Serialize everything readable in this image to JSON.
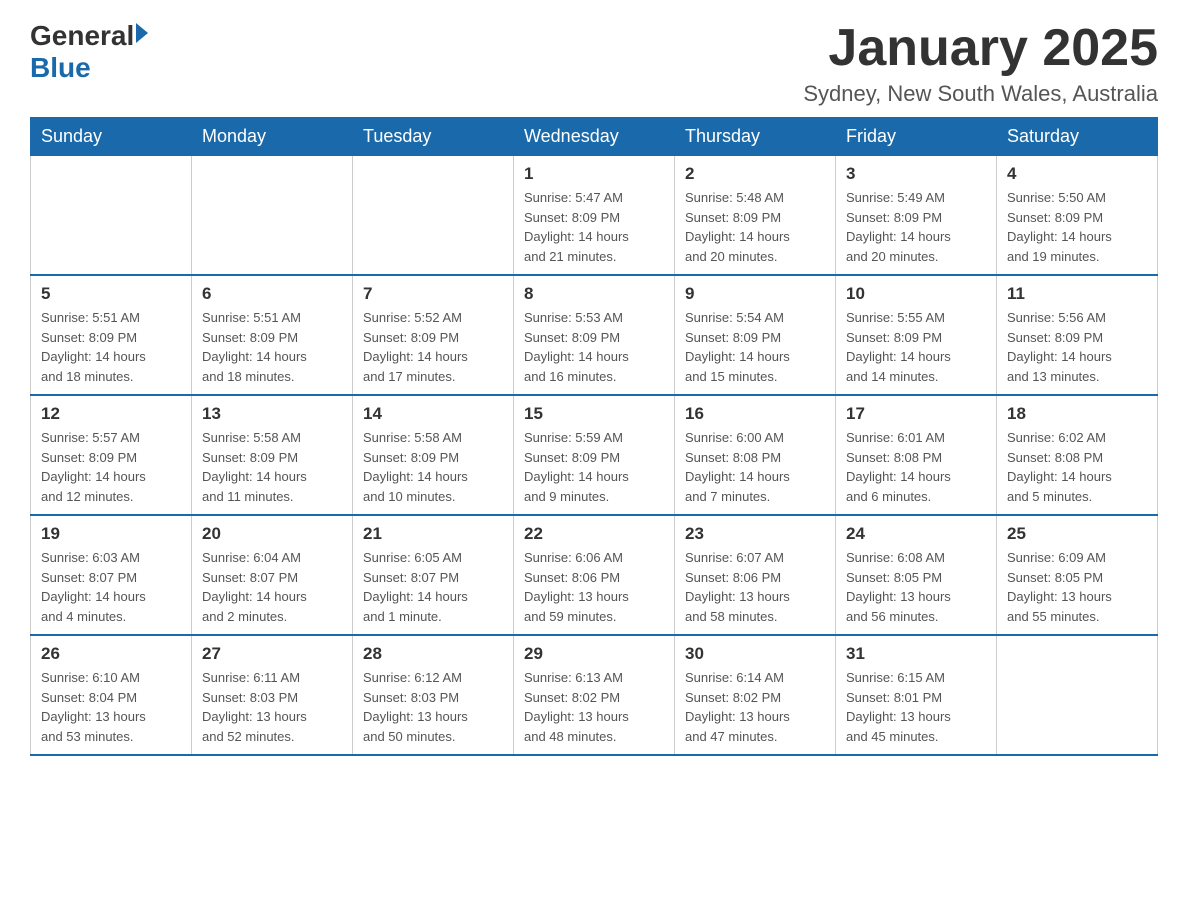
{
  "logo": {
    "general": "General",
    "blue": "Blue"
  },
  "title": "January 2025",
  "subtitle": "Sydney, New South Wales, Australia",
  "days_header": [
    "Sunday",
    "Monday",
    "Tuesday",
    "Wednesday",
    "Thursday",
    "Friday",
    "Saturday"
  ],
  "weeks": [
    [
      {
        "day": "",
        "info": ""
      },
      {
        "day": "",
        "info": ""
      },
      {
        "day": "",
        "info": ""
      },
      {
        "day": "1",
        "info": "Sunrise: 5:47 AM\nSunset: 8:09 PM\nDaylight: 14 hours\nand 21 minutes."
      },
      {
        "day": "2",
        "info": "Sunrise: 5:48 AM\nSunset: 8:09 PM\nDaylight: 14 hours\nand 20 minutes."
      },
      {
        "day": "3",
        "info": "Sunrise: 5:49 AM\nSunset: 8:09 PM\nDaylight: 14 hours\nand 20 minutes."
      },
      {
        "day": "4",
        "info": "Sunrise: 5:50 AM\nSunset: 8:09 PM\nDaylight: 14 hours\nand 19 minutes."
      }
    ],
    [
      {
        "day": "5",
        "info": "Sunrise: 5:51 AM\nSunset: 8:09 PM\nDaylight: 14 hours\nand 18 minutes."
      },
      {
        "day": "6",
        "info": "Sunrise: 5:51 AM\nSunset: 8:09 PM\nDaylight: 14 hours\nand 18 minutes."
      },
      {
        "day": "7",
        "info": "Sunrise: 5:52 AM\nSunset: 8:09 PM\nDaylight: 14 hours\nand 17 minutes."
      },
      {
        "day": "8",
        "info": "Sunrise: 5:53 AM\nSunset: 8:09 PM\nDaylight: 14 hours\nand 16 minutes."
      },
      {
        "day": "9",
        "info": "Sunrise: 5:54 AM\nSunset: 8:09 PM\nDaylight: 14 hours\nand 15 minutes."
      },
      {
        "day": "10",
        "info": "Sunrise: 5:55 AM\nSunset: 8:09 PM\nDaylight: 14 hours\nand 14 minutes."
      },
      {
        "day": "11",
        "info": "Sunrise: 5:56 AM\nSunset: 8:09 PM\nDaylight: 14 hours\nand 13 minutes."
      }
    ],
    [
      {
        "day": "12",
        "info": "Sunrise: 5:57 AM\nSunset: 8:09 PM\nDaylight: 14 hours\nand 12 minutes."
      },
      {
        "day": "13",
        "info": "Sunrise: 5:58 AM\nSunset: 8:09 PM\nDaylight: 14 hours\nand 11 minutes."
      },
      {
        "day": "14",
        "info": "Sunrise: 5:58 AM\nSunset: 8:09 PM\nDaylight: 14 hours\nand 10 minutes."
      },
      {
        "day": "15",
        "info": "Sunrise: 5:59 AM\nSunset: 8:09 PM\nDaylight: 14 hours\nand 9 minutes."
      },
      {
        "day": "16",
        "info": "Sunrise: 6:00 AM\nSunset: 8:08 PM\nDaylight: 14 hours\nand 7 minutes."
      },
      {
        "day": "17",
        "info": "Sunrise: 6:01 AM\nSunset: 8:08 PM\nDaylight: 14 hours\nand 6 minutes."
      },
      {
        "day": "18",
        "info": "Sunrise: 6:02 AM\nSunset: 8:08 PM\nDaylight: 14 hours\nand 5 minutes."
      }
    ],
    [
      {
        "day": "19",
        "info": "Sunrise: 6:03 AM\nSunset: 8:07 PM\nDaylight: 14 hours\nand 4 minutes."
      },
      {
        "day": "20",
        "info": "Sunrise: 6:04 AM\nSunset: 8:07 PM\nDaylight: 14 hours\nand 2 minutes."
      },
      {
        "day": "21",
        "info": "Sunrise: 6:05 AM\nSunset: 8:07 PM\nDaylight: 14 hours\nand 1 minute."
      },
      {
        "day": "22",
        "info": "Sunrise: 6:06 AM\nSunset: 8:06 PM\nDaylight: 13 hours\nand 59 minutes."
      },
      {
        "day": "23",
        "info": "Sunrise: 6:07 AM\nSunset: 8:06 PM\nDaylight: 13 hours\nand 58 minutes."
      },
      {
        "day": "24",
        "info": "Sunrise: 6:08 AM\nSunset: 8:05 PM\nDaylight: 13 hours\nand 56 minutes."
      },
      {
        "day": "25",
        "info": "Sunrise: 6:09 AM\nSunset: 8:05 PM\nDaylight: 13 hours\nand 55 minutes."
      }
    ],
    [
      {
        "day": "26",
        "info": "Sunrise: 6:10 AM\nSunset: 8:04 PM\nDaylight: 13 hours\nand 53 minutes."
      },
      {
        "day": "27",
        "info": "Sunrise: 6:11 AM\nSunset: 8:03 PM\nDaylight: 13 hours\nand 52 minutes."
      },
      {
        "day": "28",
        "info": "Sunrise: 6:12 AM\nSunset: 8:03 PM\nDaylight: 13 hours\nand 50 minutes."
      },
      {
        "day": "29",
        "info": "Sunrise: 6:13 AM\nSunset: 8:02 PM\nDaylight: 13 hours\nand 48 minutes."
      },
      {
        "day": "30",
        "info": "Sunrise: 6:14 AM\nSunset: 8:02 PM\nDaylight: 13 hours\nand 47 minutes."
      },
      {
        "day": "31",
        "info": "Sunrise: 6:15 AM\nSunset: 8:01 PM\nDaylight: 13 hours\nand 45 minutes."
      },
      {
        "day": "",
        "info": ""
      }
    ]
  ]
}
